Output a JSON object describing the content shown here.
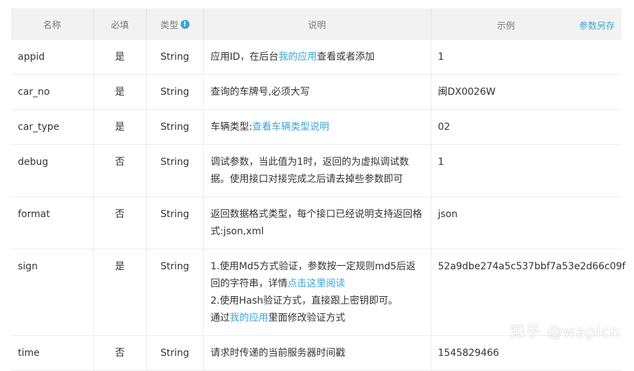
{
  "headers": {
    "name": "名称",
    "required": "必填",
    "type": "类型",
    "desc": "说明",
    "example": "示例",
    "save_as": "参数另存"
  },
  "rows": [
    {
      "name": "appid",
      "required": "是",
      "type": "String",
      "desc_pre": "应用ID，在后台",
      "desc_link": "我的应用",
      "desc_post": "查看或者添加",
      "example": "1"
    },
    {
      "name": "car_no",
      "required": "是",
      "type": "String",
      "desc": "查询的车牌号,必须大写",
      "example": "闽DX0026W"
    },
    {
      "name": "car_type",
      "required": "是",
      "type": "String",
      "desc_pre": "车辆类型:",
      "desc_link": "查看车辆类型说明",
      "example": "02"
    },
    {
      "name": "debug",
      "required": "否",
      "type": "String",
      "desc": "调试参数，当此值为1时，返回的为虚拟调试数据。使用接口对接完成之后请去掉些参数即可",
      "example": "1"
    },
    {
      "name": "format",
      "required": "否",
      "type": "String",
      "desc": "返回数据格式类型，每个接口已经说明支持返回格式:json,xml",
      "example": "json"
    },
    {
      "name": "sign",
      "required": "是",
      "type": "String",
      "desc_line1_pre": "1.使用Md5方式验证，参数按一定规则md5后返回的字符串，详情",
      "desc_line1_link": "点击这里阅读",
      "desc_line2": "2.使用Hash验证方式，直接跟上密钥即可。",
      "desc_line3_pre": "通过",
      "desc_line3_link": "我的应用",
      "desc_line3_post": "里面修改验证方式",
      "example": "52a9dbe274a5c537bbf7a53e2d66c09f"
    },
    {
      "name": "time",
      "required": "否",
      "type": "String",
      "desc": "请求时传递的当前服务器时间戳",
      "example": "1545829466"
    }
  ],
  "watermark": "知乎 @wapicn",
  "colors": {
    "link": "#3aa6d6",
    "header_bg": "#f2f2f2"
  }
}
